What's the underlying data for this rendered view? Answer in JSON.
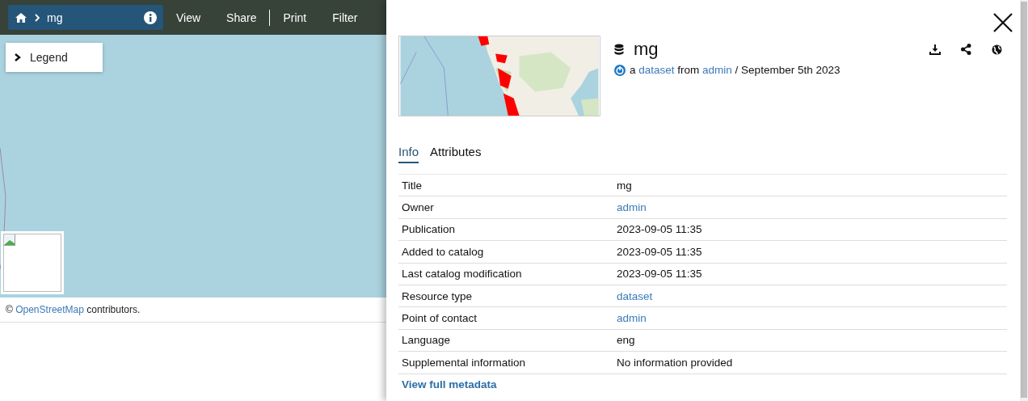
{
  "toolbar": {
    "breadcrumb": "mg",
    "items": [
      {
        "kind": "link",
        "label": "View"
      },
      {
        "kind": "link",
        "label": "Share"
      },
      {
        "kind": "separator"
      },
      {
        "kind": "link",
        "label": "Print"
      },
      {
        "kind": "link",
        "label": "Filter"
      }
    ]
  },
  "legend": {
    "label": "Legend",
    "expanded": false
  },
  "attribution": {
    "symbol": "©",
    "link": "OpenStreetMap",
    "suffix": "contributors."
  },
  "panel": {
    "title": "mg",
    "byline": {
      "article": "a",
      "type": "dataset",
      "from": "from",
      "owner": "admin",
      "date": "/ September 5th 2023"
    },
    "tabs": [
      {
        "label": "Info",
        "selected": true
      },
      {
        "label": "Attributes",
        "selected": false
      }
    ],
    "rows": [
      {
        "label": "Title",
        "value": "mg",
        "kind": "text"
      },
      {
        "label": "Owner",
        "value": "admin",
        "kind": "link"
      },
      {
        "label": "Publication",
        "value": "2023-09-05 11:35",
        "kind": "text"
      },
      {
        "label": "Added to catalog",
        "value": "2023-09-05 11:35",
        "kind": "text"
      },
      {
        "label": "Last catalog modification",
        "value": "2023-09-05 11:35",
        "kind": "text"
      },
      {
        "label": "Resource type",
        "value": "dataset",
        "kind": "link"
      },
      {
        "label": "Point of contact",
        "value": "admin",
        "kind": "link"
      },
      {
        "label": "Language",
        "value": "eng",
        "kind": "text"
      },
      {
        "label": "Supplemental information",
        "value": "No information provided",
        "kind": "text"
      }
    ],
    "footer_link": "View full metadata"
  }
}
